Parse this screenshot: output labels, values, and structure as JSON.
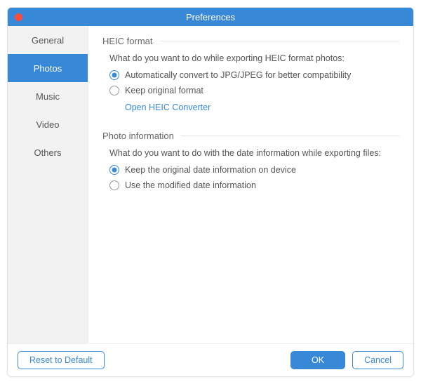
{
  "window": {
    "title": "Preferences"
  },
  "sidebar": {
    "items": [
      {
        "label": "General",
        "active": false
      },
      {
        "label": "Photos",
        "active": true
      },
      {
        "label": "Music",
        "active": false
      },
      {
        "label": "Video",
        "active": false
      },
      {
        "label": "Others",
        "active": false
      }
    ]
  },
  "heic": {
    "title": "HEIC format",
    "desc": "What do you want to do while exporting HEIC format photos:",
    "opt1": "Automatically convert to JPG/JPEG for better compatibility",
    "opt2": "Keep original format",
    "link": "Open HEIC Converter"
  },
  "photoInfo": {
    "title": "Photo information",
    "desc": "What do you want to do with the date information while exporting files:",
    "opt1": "Keep the original date information on device",
    "opt2": "Use the modified date information"
  },
  "footer": {
    "reset": "Reset to Default",
    "ok": "OK",
    "cancel": "Cancel"
  }
}
